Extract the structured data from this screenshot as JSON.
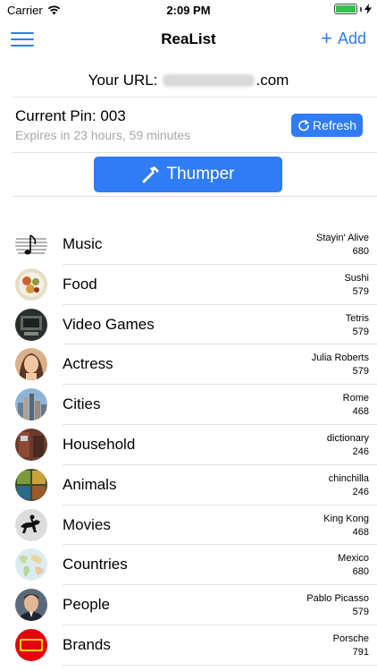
{
  "status": {
    "carrier": "Carrier",
    "time": "2:09 PM"
  },
  "nav": {
    "title": "ReaList",
    "add_label": "Add"
  },
  "url": {
    "prefix": "Your URL:",
    "suffix": ".com"
  },
  "pin": {
    "title": "Current Pin: 003",
    "expires": "Expires in 23 hours, 59 minutes",
    "refresh_label": "Refresh"
  },
  "thumper": {
    "label": "Thumper"
  },
  "colors": {
    "accent": "#2f7cf6",
    "battery": "#33c24d"
  },
  "list": [
    {
      "label": "Music",
      "detail": "Stayin' Alive",
      "count": "680",
      "icon": "music-notes-icon"
    },
    {
      "label": "Food",
      "detail": "Sushi",
      "count": "579",
      "icon": "food-plate-icon"
    },
    {
      "label": "Video Games",
      "detail": "Tetris",
      "count": "579",
      "icon": "video-games-icon"
    },
    {
      "label": "Actress",
      "detail": "Julia Roberts",
      "count": "579",
      "icon": "actress-photo-icon"
    },
    {
      "label": "Cities",
      "detail": "Rome",
      "count": "468",
      "icon": "city-skyline-icon"
    },
    {
      "label": "Household",
      "detail": "dictionary",
      "count": "246",
      "icon": "household-icon"
    },
    {
      "label": "Animals",
      "detail": "chinchilla",
      "count": "246",
      "icon": "animals-icon"
    },
    {
      "label": "Movies",
      "detail": "King Kong",
      "count": "468",
      "icon": "horse-rider-icon"
    },
    {
      "label": "Countries",
      "detail": "Mexico",
      "count": "680",
      "icon": "world-map-icon"
    },
    {
      "label": "People",
      "detail": "Pablo Picasso",
      "count": "579",
      "icon": "person-photo-icon"
    },
    {
      "label": "Brands",
      "detail": "Porsche",
      "count": "791",
      "icon": "lego-logo-icon"
    }
  ]
}
